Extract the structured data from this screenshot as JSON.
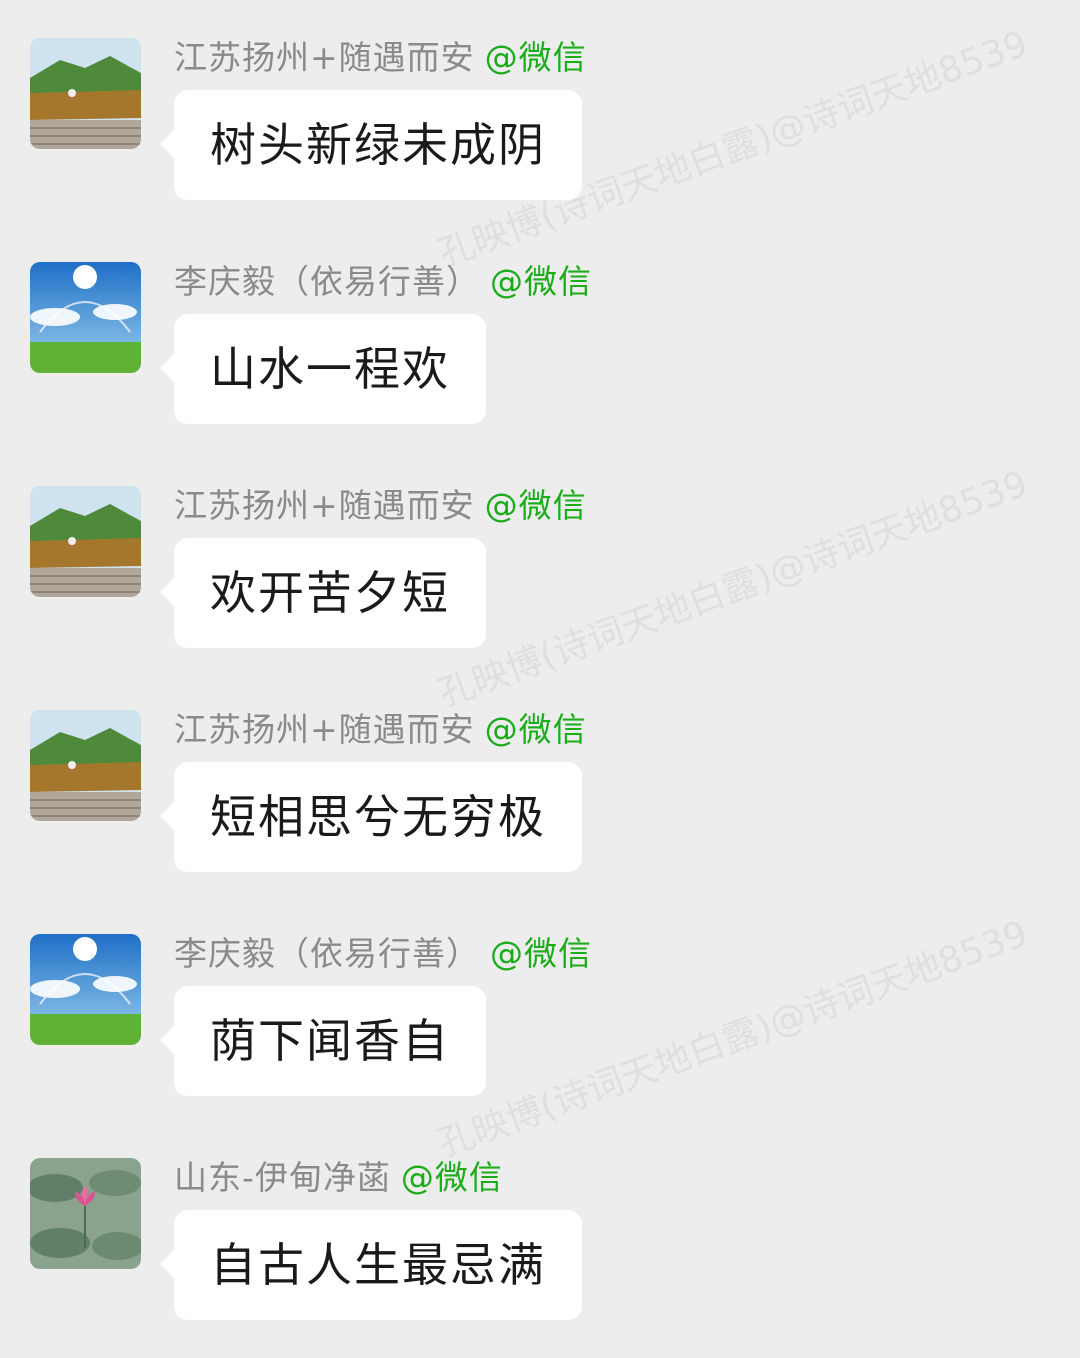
{
  "watermark": "孔映博(诗词天地白露)@诗词天地8539",
  "messages": [
    {
      "sender": "江苏扬州+随遇而安",
      "suffix": "@微信",
      "text": "树头新绿未成阴",
      "avatar": "mountain-avatar-icon"
    },
    {
      "sender": "李庆毅（依易行善）",
      "suffix": "@微信",
      "text": "山水一程欢",
      "avatar": "sky-avatar-icon"
    },
    {
      "sender": "江苏扬州+随遇而安",
      "suffix": "@微信",
      "text": "欢开苦夕短",
      "avatar": "mountain-avatar-icon"
    },
    {
      "sender": "江苏扬州+随遇而安",
      "suffix": "@微信",
      "text": "短相思兮无穷极",
      "avatar": "mountain-avatar-icon"
    },
    {
      "sender": "李庆毅（依易行善）",
      "suffix": "@微信",
      "text": "荫下闻香自",
      "avatar": "sky-avatar-icon"
    },
    {
      "sender": "山东-伊甸净菡",
      "suffix": "@微信",
      "text": "自古人生最忌满",
      "avatar": "lotus-avatar-icon"
    }
  ],
  "colors": {
    "background": "#ededed",
    "bubble": "#ffffff",
    "suffix": "#1aad19",
    "sender": "#8a8a8a"
  }
}
